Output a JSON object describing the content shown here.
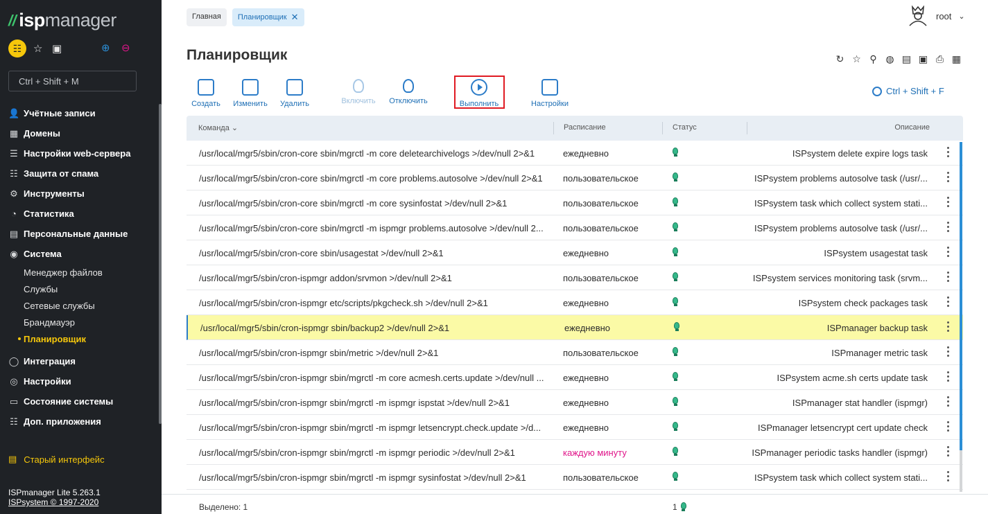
{
  "sidebar": {
    "logo_prefix": "isp",
    "logo_suffix": "manager",
    "search_placeholder": "Ctrl + Shift + M",
    "items": [
      {
        "label": "Учётные записи",
        "icon": "users-icon",
        "glyph": "👤"
      },
      {
        "label": "Домены",
        "icon": "domains-icon",
        "glyph": "▦"
      },
      {
        "label": "Настройки web-сервера",
        "icon": "webserver-settings-icon",
        "glyph": "☰"
      },
      {
        "label": "Защита от спама",
        "icon": "spam-protection-icon",
        "glyph": "☷"
      },
      {
        "label": "Инструменты",
        "icon": "tools-icon",
        "glyph": "⚙"
      },
      {
        "label": "Статистика",
        "icon": "statistics-icon",
        "glyph": "◔"
      },
      {
        "label": "Персональные данные",
        "icon": "personal-data-icon",
        "glyph": "▤"
      },
      {
        "label": "Система",
        "icon": "system-icon",
        "glyph": "◉"
      }
    ],
    "sub_items": [
      "Менеджер файлов",
      "Службы",
      "Сетевые службы",
      "Брандмауэр",
      "Планировщик"
    ],
    "items_after": [
      {
        "label": "Интеграция",
        "icon": "integration-icon",
        "glyph": "◯"
      },
      {
        "label": "Настройки",
        "icon": "settings-icon",
        "glyph": "◎"
      },
      {
        "label": "Состояние системы",
        "icon": "system-state-icon",
        "glyph": "▭"
      },
      {
        "label": "Доп. приложения",
        "icon": "apps-icon",
        "glyph": "☷"
      }
    ],
    "old_interface": "Старый интерфейс",
    "version_line1": "ISPmanager Lite 5.263.1",
    "version_line2": "ISPsystem © 1997-2020"
  },
  "breadcrumbs": [
    "Главная",
    "Планировщик"
  ],
  "user": "root",
  "page_title": "Планировщик",
  "toolbar": {
    "create": "Создать",
    "edit": "Изменить",
    "delete": "Удалить",
    "enable": "Включить",
    "disable": "Отключить",
    "run": "Выполнить",
    "settings": "Настройки",
    "search_hint": "Ctrl + Shift + F"
  },
  "table": {
    "headers": {
      "command": "Команда",
      "schedule": "Расписание",
      "status": "Статус",
      "description": "Описание"
    },
    "rows": [
      {
        "command": "/usr/local/mgr5/sbin/cron-core sbin/mgrctl -m core deletearchivelogs >/dev/null 2>&1",
        "schedule": "ежедневно",
        "description": "ISPsystem delete expire logs task"
      },
      {
        "command": "/usr/local/mgr5/sbin/cron-core sbin/mgrctl -m core problems.autosolve >/dev/null 2>&1",
        "schedule": "пользовательское",
        "description": "ISPsystem problems autosolve task (/usr/..."
      },
      {
        "command": "/usr/local/mgr5/sbin/cron-core sbin/mgrctl -m core sysinfostat >/dev/null 2>&1",
        "schedule": "пользовательское",
        "description": "ISPsystem task which collect system stati..."
      },
      {
        "command": "/usr/local/mgr5/sbin/cron-core sbin/mgrctl -m ispmgr problems.autosolve >/dev/null 2...",
        "schedule": "пользовательское",
        "description": "ISPsystem problems autosolve task (/usr/..."
      },
      {
        "command": "/usr/local/mgr5/sbin/cron-core sbin/usagestat >/dev/null 2>&1",
        "schedule": "ежедневно",
        "description": "ISPsystem usagestat task"
      },
      {
        "command": "/usr/local/mgr5/sbin/cron-ispmgr addon/srvmon >/dev/null 2>&1",
        "schedule": "пользовательское",
        "description": "ISPsystem services monitoring task (srvm..."
      },
      {
        "command": "/usr/local/mgr5/sbin/cron-ispmgr etc/scripts/pkgcheck.sh >/dev/null 2>&1",
        "schedule": "ежедневно",
        "description": "ISPsystem check packages task"
      },
      {
        "command": "/usr/local/mgr5/sbin/cron-ispmgr sbin/backup2 >/dev/null 2>&1",
        "schedule": "ежедневно",
        "description": "ISPmanager backup task"
      },
      {
        "command": "/usr/local/mgr5/sbin/cron-ispmgr sbin/metric >/dev/null 2>&1",
        "schedule": "пользовательское",
        "description": "ISPmanager metric task"
      },
      {
        "command": "/usr/local/mgr5/sbin/cron-ispmgr sbin/mgrctl -m core acmesh.certs.update >/dev/null ...",
        "schedule": "ежедневно",
        "description": "ISPsystem acme.sh certs update task"
      },
      {
        "command": "/usr/local/mgr5/sbin/cron-ispmgr sbin/mgrctl -m ispmgr ispstat >/dev/null 2>&1",
        "schedule": "ежедневно",
        "description": "ISPmanager stat handler (ispmgr)"
      },
      {
        "command": "/usr/local/mgr5/sbin/cron-ispmgr sbin/mgrctl -m ispmgr letsencrypt.check.update >/d...",
        "schedule": "ежедневно",
        "description": "ISPmanager letsencrypt cert update check"
      },
      {
        "command": "/usr/local/mgr5/sbin/cron-ispmgr sbin/mgrctl -m ispmgr periodic >/dev/null 2>&1",
        "schedule": "каждую минуту",
        "description": "ISPmanager periodic tasks handler (ispmgr)"
      },
      {
        "command": "/usr/local/mgr5/sbin/cron-ispmgr sbin/mgrctl -m ispmgr sysinfostat >/dev/null 2>&1",
        "schedule": "пользовательское",
        "description": "ISPsystem task which collect system stati..."
      }
    ],
    "selected_row_index": 7
  },
  "footer": {
    "selected": "Выделено: 1",
    "count": "1"
  },
  "colors": {
    "accent": "#2c7cc8",
    "highlight": "#fbfaa6",
    "pink": "#e0168a",
    "sidebar_bg": "#1f2226",
    "active_nav": "#f5c70b"
  }
}
